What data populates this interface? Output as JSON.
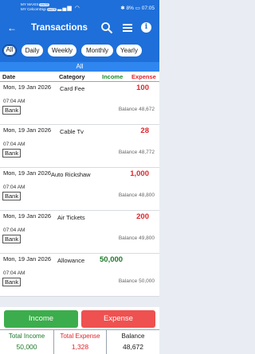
{
  "status_bar": {
    "carrier_line1": "MY MAXIS",
    "carrier_line1_badge": "VoLTE",
    "carrier_line2": "MY CelcomDigi",
    "carrier_line2_badge": "VoLTE",
    "battery": "8%",
    "time": "07:05"
  },
  "header": {
    "title": "Transactions",
    "colors": {
      "primary": "#1e6fd9",
      "income": "#1e7a2a",
      "expense": "#e0262c"
    }
  },
  "filters": [
    {
      "label": "All",
      "active": true
    },
    {
      "label": "Daily",
      "active": false
    },
    {
      "label": "Weekly",
      "active": false
    },
    {
      "label": "Monthly",
      "active": false
    },
    {
      "label": "Yearly",
      "active": false
    }
  ],
  "section_label": "All",
  "columns": {
    "date": "Date",
    "category": "Category",
    "income": "Income",
    "expense": "Expense"
  },
  "transactions": [
    {
      "date": "Mon, 19 Jan 2026",
      "time": "07:04 AM",
      "account": "Bank",
      "category": "Card Fee",
      "income": "",
      "expense": "100",
      "balance": "Balance 48,672"
    },
    {
      "date": "Mon, 19 Jan 2026",
      "time": "07:04 AM",
      "account": "Bank",
      "category": "Cable Tv",
      "income": "",
      "expense": "28",
      "balance": "Balance 48,772"
    },
    {
      "date": "Mon, 19 Jan 2026",
      "time": "07:04 AM",
      "account": "Bank",
      "category": "Auto Rickshaw",
      "income": "",
      "expense": "1,000",
      "balance": "Balance 48,800"
    },
    {
      "date": "Mon, 19 Jan 2026",
      "time": "07:04 AM",
      "account": "Bank",
      "category": "Air Tickets",
      "income": "",
      "expense": "200",
      "balance": "Balance 49,800"
    },
    {
      "date": "Mon, 19 Jan 2026",
      "time": "07:04 AM",
      "account": "Bank",
      "category": "Allowance",
      "income": "50,000",
      "expense": "",
      "balance": "Balance 50,000"
    }
  ],
  "buttons": {
    "income": "Income",
    "expense": "Expense"
  },
  "totals": {
    "income_label": "Total Income",
    "income_value": "50,000",
    "expense_label": "Total Expense",
    "expense_value": "1,328",
    "balance_label": "Balance",
    "balance_value": "48,672"
  }
}
